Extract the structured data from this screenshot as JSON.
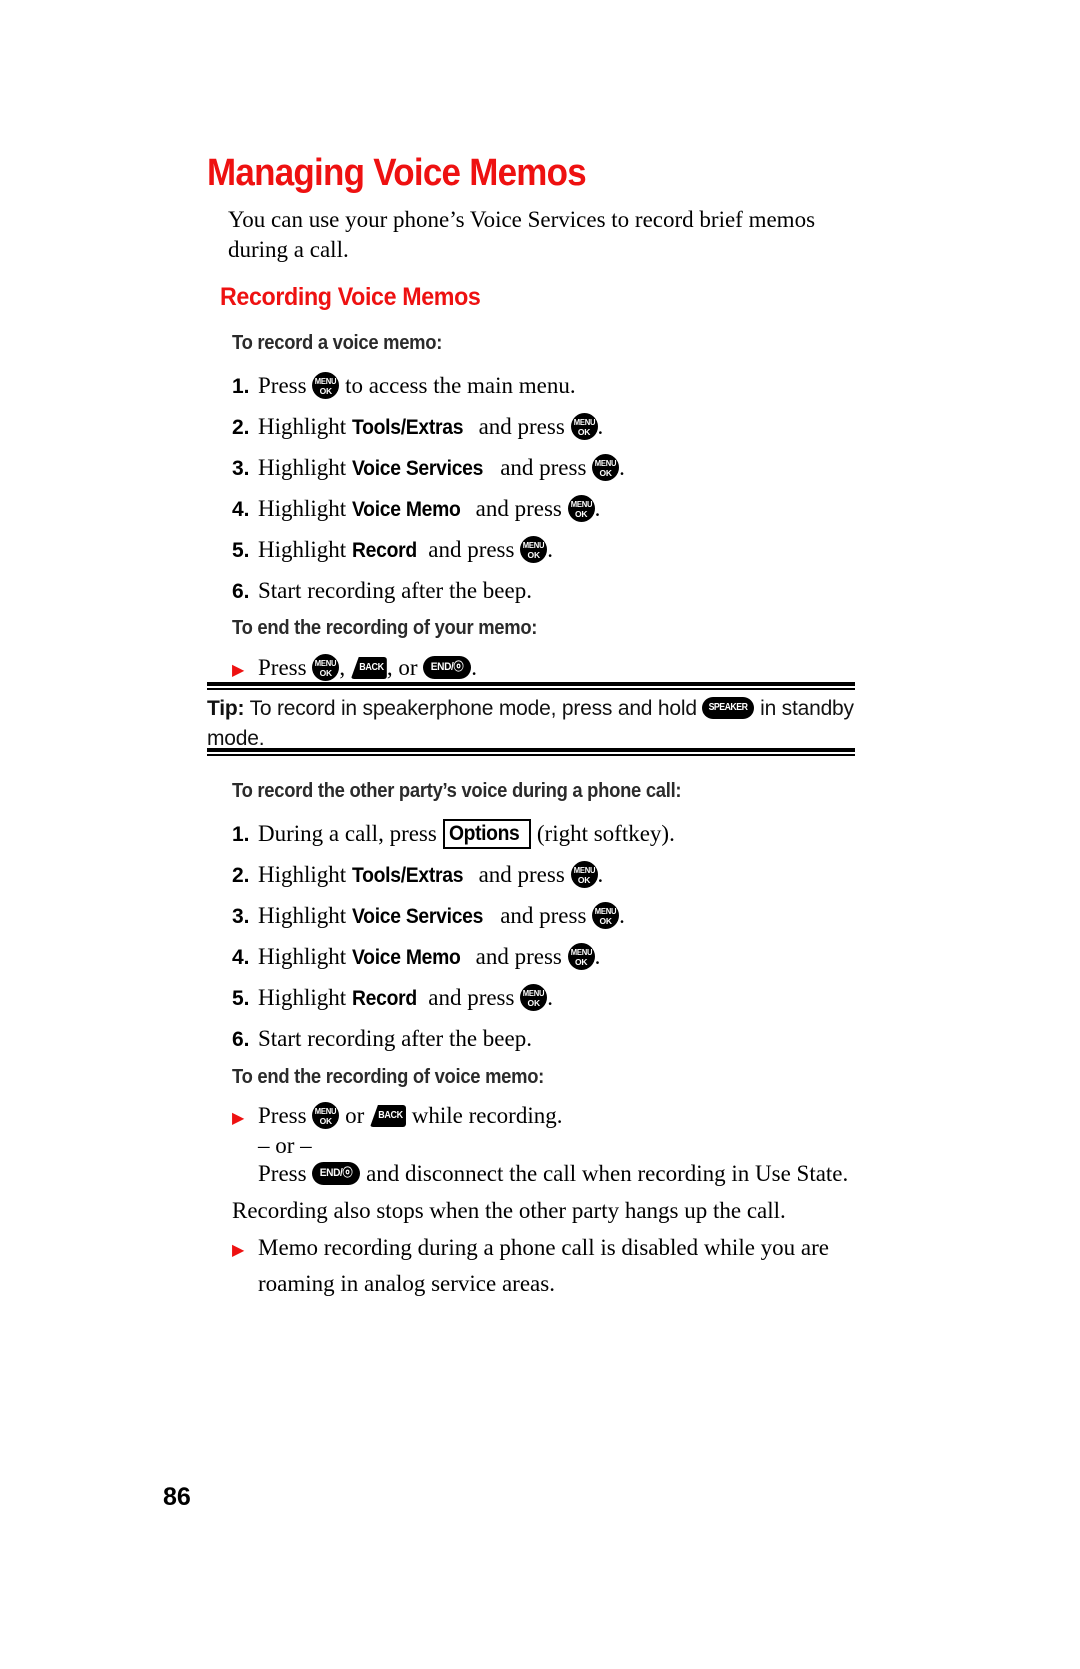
{
  "page": {
    "number": "86",
    "title": "Managing Voice Memos",
    "intro": "You can use your phone’s Voice Services to record brief memos during a call."
  },
  "colors": {
    "heading_red": "#ee1111",
    "bullet_red": "#ee1111",
    "text_black": "#000000"
  },
  "keys": {
    "menu_ok": {
      "line1": "MENU",
      "line2": "OK",
      "name": "menu-ok-key"
    },
    "back": {
      "line1": "BACK",
      "name": "back-key"
    },
    "end": {
      "line1": "END/ⓞ",
      "name": "end-power-key"
    },
    "speaker": {
      "line1": "SPEAKER",
      "name": "speaker-key"
    },
    "options_softkey": "Options"
  },
  "section1": {
    "heading": "Recording Voice Memos",
    "sub1": "To record a voice memo:",
    "steps": [
      {
        "num": "1.",
        "pre": "Press ",
        "key": "menu_ok",
        "post": " to access the main menu."
      },
      {
        "num": "2.",
        "pre": "Highlight ",
        "bold": "Tools/Extras",
        "mid": " and press ",
        "key": "menu_ok",
        "post": "."
      },
      {
        "num": "3.",
        "pre": "Highlight ",
        "bold": "Voice Services",
        "mid": " and press ",
        "key": "menu_ok",
        "post": "."
      },
      {
        "num": "4.",
        "pre": "Highlight ",
        "bold": "Voice Memo",
        "mid": " and press ",
        "key": "menu_ok",
        "post": "."
      },
      {
        "num": "5.",
        "pre": "Highlight ",
        "bold": "Record",
        "mid": " and press ",
        "key": "menu_ok",
        "post": "."
      },
      {
        "num": "6.",
        "pre": "Start recording after the beep.",
        "bold": "",
        "mid": "",
        "post": ""
      }
    ],
    "sub2": "To end the recording of your memo:",
    "end_step": {
      "pre": "Press ",
      "mid1": ", ",
      "mid2": ", or ",
      "post": "."
    }
  },
  "tip": {
    "label": "Tip:",
    "text_before_key": " To record in speakerphone mode, press and hold ",
    "text_after_key": " in standby mode."
  },
  "section2": {
    "sub1": "To record the other party’s voice during a phone call:",
    "step1": {
      "num": "1.",
      "pre": "During a call, press ",
      "softkey": "Options",
      "post": " (right softkey)."
    },
    "steps": [
      {
        "num": "2.",
        "pre": "Highlight ",
        "bold": "Tools/Extras",
        "mid": " and press ",
        "key": "menu_ok",
        "post": "."
      },
      {
        "num": "3.",
        "pre": "Highlight ",
        "bold": "Voice Services",
        "mid": " and press ",
        "key": "menu_ok",
        "post": "."
      },
      {
        "num": "4.",
        "pre": "Highlight ",
        "bold": "Voice Memo",
        "mid": " and press ",
        "key": "menu_ok",
        "post": "."
      },
      {
        "num": "5.",
        "pre": "Highlight ",
        "bold": "Record",
        "mid": " and press ",
        "key": "menu_ok",
        "post": "."
      },
      {
        "num": "6.",
        "pre": "Start recording after the beep.",
        "bold": "",
        "mid": "",
        "post": ""
      }
    ],
    "sub2": "To end the recording of voice memo:",
    "end_step": {
      "pre": "Press ",
      "mid": " or ",
      "post": " while recording."
    },
    "or_separator": "– or –",
    "end_alt": {
      "pre": "Press ",
      "post": " and disconnect the call when recording in Use State."
    },
    "note": "Recording also stops when the other party hangs up the call.",
    "bullet_note": "Memo recording during a phone call is disabled while you are roaming in analog service areas."
  }
}
